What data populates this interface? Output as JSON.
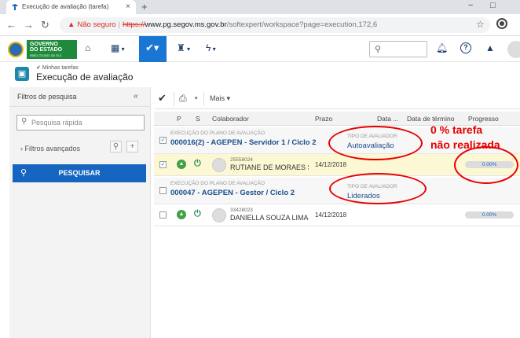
{
  "browser": {
    "tab_title": "Execução de avaliação (tarefa)",
    "tab_close": "×",
    "new_tab": "+",
    "security_label": "Não seguro",
    "url_scheme": "https://",
    "url_host": "www.pg.segov.ms.gov.br",
    "url_path": "/softexpert/workspace?page=execution,172,6"
  },
  "logo": {
    "line1": "GOVERNO",
    "line2": "DO ESTADO",
    "line3": "Mato Grosso do Sul"
  },
  "page": {
    "breadcrumb": "Minhas tarefas",
    "title": "Execução de avaliação"
  },
  "filters": {
    "header": "Filtros de pesquisa",
    "collapse_glyph": "«",
    "quick_search_placeholder": "Pesquisa rápida",
    "advanced_label": "Filtros avançados",
    "search_button": "PESQUISAR"
  },
  "toolbar": {
    "more_label": "Mais"
  },
  "table": {
    "columns": {
      "p": "P",
      "s": "S",
      "collaborator": "Colaborador",
      "deadline": "Prazo",
      "date": "Data ...",
      "end_date": "Data de término",
      "progress": "Progresso"
    },
    "groups": [
      {
        "plan_label": "EXECUÇÃO DO PLANO DE AVALIAÇÃO",
        "plan_title": "000016(2) - AGEPEN - Servidor 1 / Ciclo 2",
        "type_label": "TIPO DE AVALIADOR",
        "type_value": "Autoavaliação",
        "row": {
          "id": "25558024",
          "name": "RUTIANE DE MORAES S.",
          "deadline": "14/12/2018",
          "progress": "0.00%"
        }
      },
      {
        "plan_label": "EXECUÇÃO DO PLANO DE AVALIAÇÃO",
        "plan_title": "000047 - AGEPEN - Gestor / Ciclo 2",
        "type_label": "TIPO DE AVALIADOR",
        "type_value": "Liderados",
        "row": {
          "id": "33428023",
          "name": "DANIELLA SOUZA LIMA S",
          "deadline": "14/12/2018",
          "progress": "0.00%"
        }
      }
    ]
  },
  "annotation": {
    "line1": "0 % tarefa",
    "line2": "não realizada"
  },
  "colors": {
    "accent": "#1976d2",
    "search_button": "#1565c0",
    "annotation": "#e60000",
    "highlight_row": "#fdf8d4"
  }
}
